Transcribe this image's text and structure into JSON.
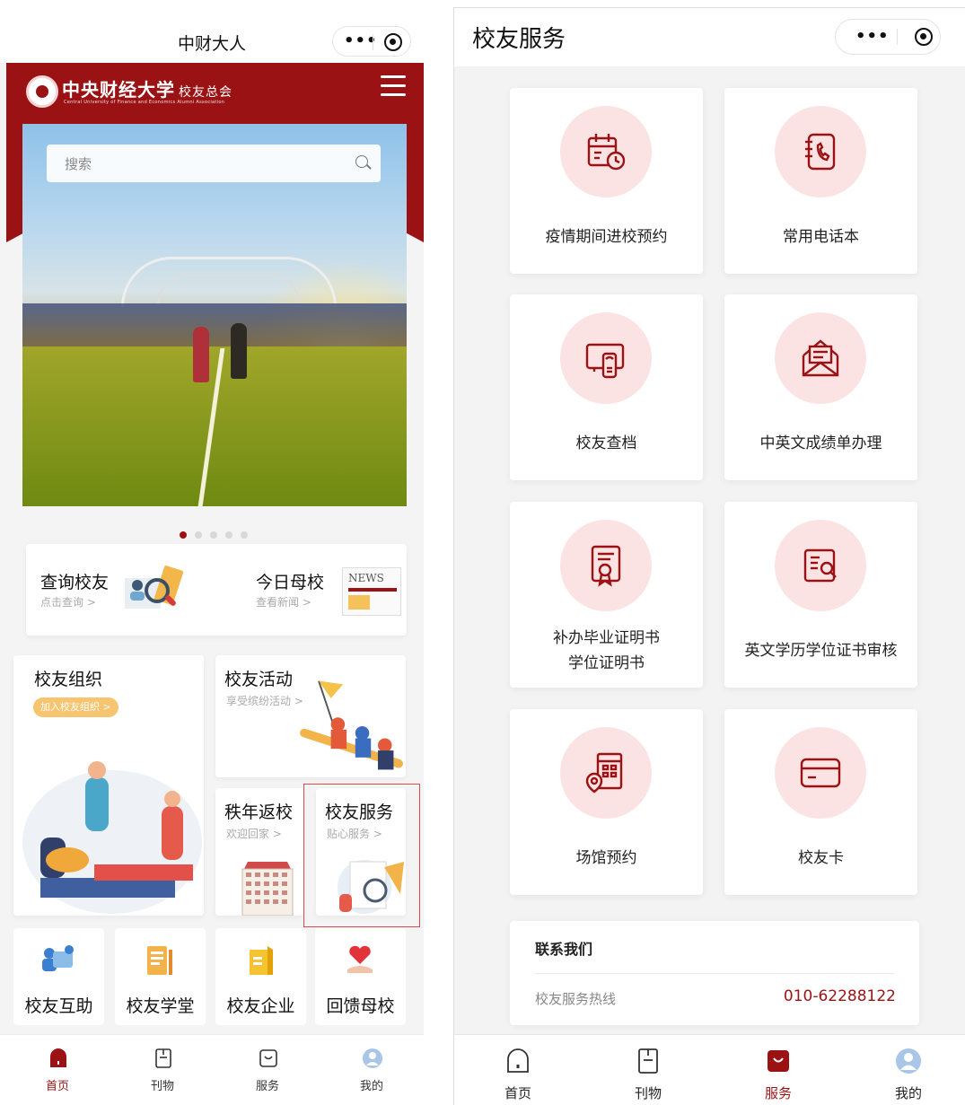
{
  "left": {
    "nav_title": "中财大人",
    "capsule": {
      "more": "•••"
    },
    "brand": {
      "cn": "中央财经大学",
      "cn_sub": "校友总会",
      "en": "Central University of Finance and Economics Alumni Association"
    },
    "search": {
      "placeholder": "搜索"
    },
    "carousel": {
      "count": 5,
      "active": 1
    },
    "quick": [
      {
        "title": "查询校友",
        "sub": "点击查询 >"
      },
      {
        "title": "今日母校",
        "sub": "查看新闻 >",
        "badge": "NEWS"
      }
    ],
    "cards": {
      "org": {
        "title": "校友组织",
        "pill": "加入校友组织 >"
      },
      "activity": {
        "title": "校友活动",
        "sub": "享受缤纷活动 >"
      },
      "return": {
        "title": "秩年返校",
        "sub": "欢迎回家 >"
      },
      "service": {
        "title": "校友服务",
        "sub": "贴心服务 >"
      }
    },
    "tiles": [
      "校友互助",
      "校友学堂",
      "校友企业",
      "回馈母校"
    ],
    "tabs": [
      "首页",
      "刊物",
      "服务",
      "我的"
    ],
    "active_tab": "首页"
  },
  "right": {
    "nav_title": "校友服务",
    "capsule": {
      "more": "•••"
    },
    "services": [
      {
        "label": "疫情期间进校预约",
        "icon": "calendar-clock-icon"
      },
      {
        "label": "常用电话本",
        "icon": "phonebook-icon"
      },
      {
        "label": "校友查档",
        "icon": "archive-terminal-icon"
      },
      {
        "label": "中英文成绩单办理",
        "icon": "envelope-letter-icon"
      },
      {
        "label_line1": "补办毕业证明书",
        "label_line2": "学位证明书",
        "icon": "certificate-icon"
      },
      {
        "label": "英文学历学位证书审核",
        "icon": "document-search-icon"
      },
      {
        "label": "场馆预约",
        "icon": "venue-location-icon"
      },
      {
        "label": "校友卡",
        "icon": "card-icon"
      }
    ],
    "contact": {
      "title": "联系我们",
      "hotline_label": "校友服务热线",
      "hotline_number": "010-62288122"
    },
    "tabs": [
      "首页",
      "刊物",
      "服务",
      "我的"
    ],
    "active_tab": "服务"
  },
  "colors": {
    "brand": "#9b1214",
    "icon_bg": "#fbe3e3",
    "pill": "#f7c470"
  }
}
